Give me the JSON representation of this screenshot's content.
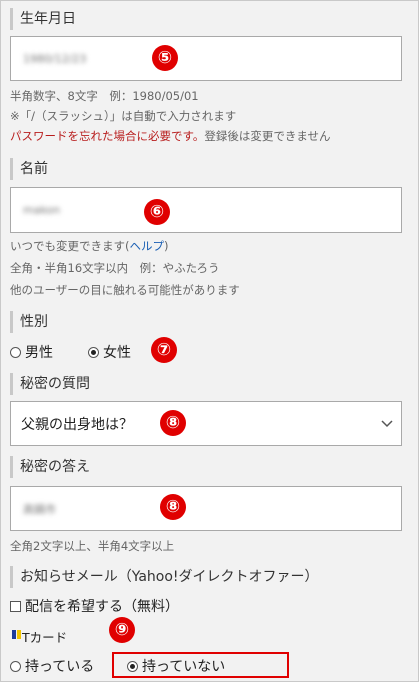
{
  "birthdate": {
    "title": "生年月日",
    "value": "1980/12/23",
    "badge": "⑤",
    "hint1": "半角数字、8文字　例：1980/05/01",
    "hint2": "※「/（スラッシュ）」は自動で入力されます",
    "warning_red": "パスワードを忘れた場合に必要です。",
    "warning_gray": "登録後は変更できません"
  },
  "name": {
    "title": "名前",
    "value": "makon",
    "badge": "⑥",
    "hint1_prefix": "いつでも変更できます(",
    "hint1_link": "ヘルプ",
    "hint1_suffix": ")",
    "hint2": "全角・半角16文字以内　例：やふたろう",
    "hint3": "他のユーザーの目に触れる可能性があります"
  },
  "gender": {
    "title": "性別",
    "options": [
      "男性",
      "女性"
    ],
    "selected": "女性",
    "badge": "⑦"
  },
  "secret_question": {
    "title": "秘密の質問",
    "selected": "父親の出身地は？",
    "badge": "⑧"
  },
  "secret_answer": {
    "title": "秘密の答え",
    "value": "高鍋市",
    "badge": "⑧",
    "hint": "全角2文字以上、半角4文字以上"
  },
  "newsletter": {
    "title": "お知らせメール（Yahoo!ダイレクトオファー）",
    "checkbox_label": "配信を希望する（無料）",
    "checked": false
  },
  "tcard": {
    "title": "Tカード",
    "badge": "⑨",
    "options": [
      "持っている",
      "持っていない"
    ],
    "selected": "持っていない"
  },
  "colors": {
    "badge": "#e00000",
    "warning": "#b81d1d",
    "link": "#1a5fb4",
    "tcard_blue": "#1f3c9a",
    "tcard_yellow": "#f2c400"
  }
}
